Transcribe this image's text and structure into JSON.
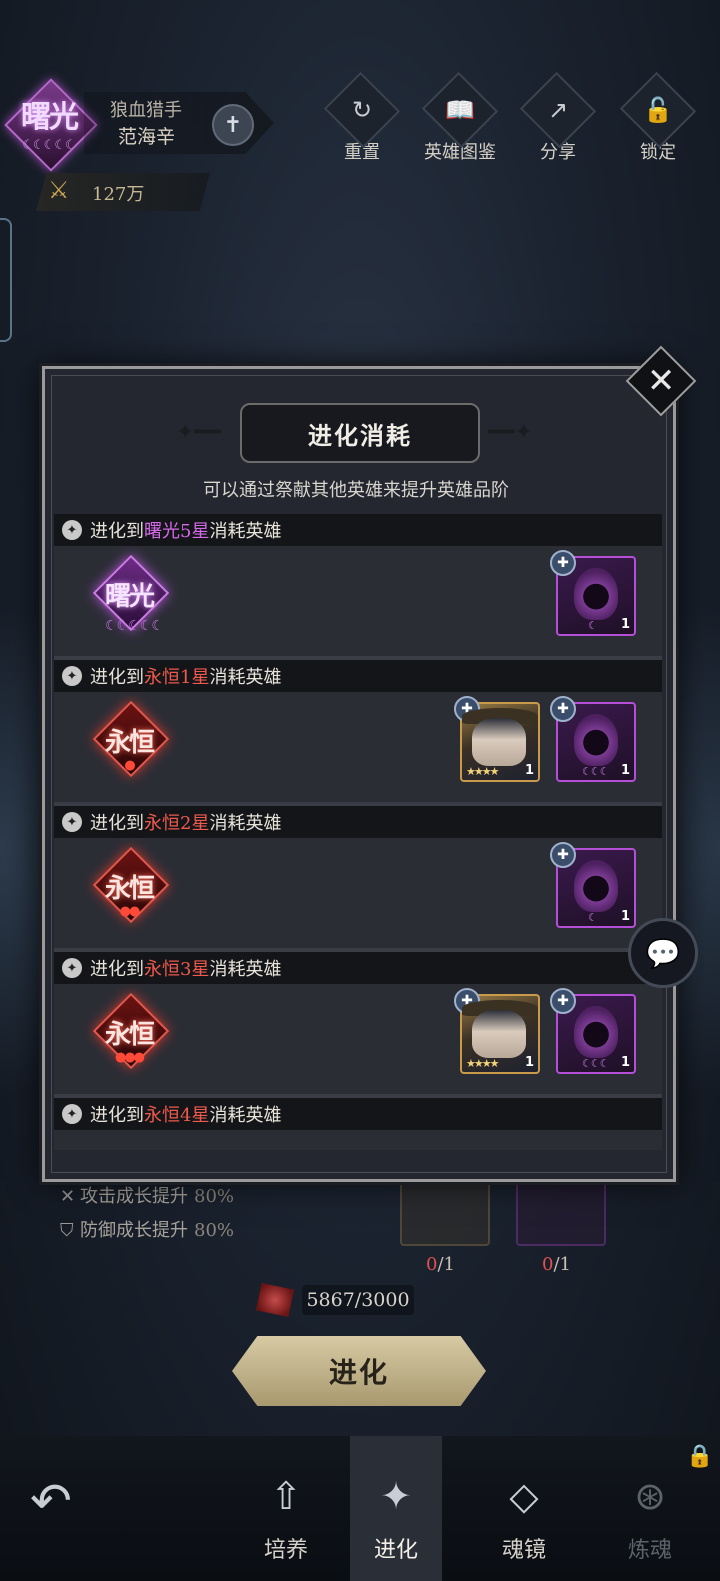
{
  "header": {
    "rank_text": "曙光",
    "rank_moons": "☾☾☾☾☾",
    "hero_title": "狼血猎手",
    "hero_name": "范海辛",
    "power": "127万"
  },
  "top_buttons": [
    {
      "label": "重置",
      "icon": "↻"
    },
    {
      "label": "英雄图鉴",
      "icon": "📖"
    },
    {
      "label": "分享",
      "icon": "↗"
    },
    {
      "label": "锁定",
      "icon": "🔓"
    }
  ],
  "modal": {
    "title": "进化消耗",
    "subtitle": "可以通过祭献其他英雄来提升英雄品阶",
    "close_glyph": "✕",
    "sections": [
      {
        "prefix": "进化到",
        "tier": "曙光5星",
        "suffix": "消耗英雄",
        "badge_text": "曙光",
        "badge_marks": "☾☾☾☾☾",
        "cards": [
          {
            "count": "1",
            "marks": "☾"
          }
        ]
      },
      {
        "prefix": "进化到",
        "tier": "永恒1星",
        "suffix": "消耗英雄",
        "badge_text": "永恒",
        "badge_marks": "●",
        "cards": [
          {
            "count": "1",
            "marks": "★★★★"
          },
          {
            "count": "1",
            "marks": "☾☾☾"
          }
        ]
      },
      {
        "prefix": "进化到",
        "tier": "永恒2星",
        "suffix": "消耗英雄",
        "badge_text": "永恒",
        "badge_marks": "●●",
        "cards": [
          {
            "count": "1",
            "marks": "☾"
          }
        ]
      },
      {
        "prefix": "进化到",
        "tier": "永恒3星",
        "suffix": "消耗英雄",
        "badge_text": "永恒",
        "badge_marks": "●●●",
        "cards": [
          {
            "count": "1",
            "marks": "★★★★"
          },
          {
            "count": "1",
            "marks": "☾☾☾"
          }
        ]
      },
      {
        "prefix": "进化到",
        "tier": "永恒4星",
        "suffix": "消耗英雄"
      }
    ]
  },
  "stats": [
    {
      "label": "攻击成长提升",
      "value": "80%"
    },
    {
      "label": "防御成长提升",
      "value": "80%"
    }
  ],
  "requirements": [
    {
      "have": "0",
      "need": "/1"
    },
    {
      "have": "0",
      "need": "/1"
    }
  ],
  "cost": "5867/3000",
  "evolve_button": "进化",
  "bottom_nav": [
    {
      "label": "培养",
      "icon": "⇧"
    },
    {
      "label": "进化",
      "icon": "✦"
    },
    {
      "label": "魂镜",
      "icon": "◇"
    },
    {
      "label": "炼魂",
      "icon": "⊛"
    }
  ]
}
